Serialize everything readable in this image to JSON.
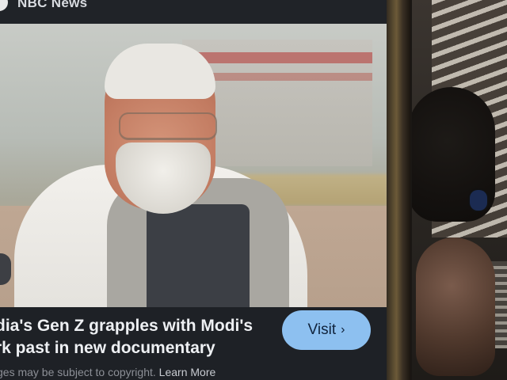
{
  "card": {
    "source": "NBC News",
    "headline_line1": "dia's Gen Z grapples with Modi's",
    "headline_line2": "rk past in new documentary",
    "visit_label": "Visit",
    "visit_chevron": "›",
    "copyright_text": "ges may be subject to copyright.",
    "learn_more": "Learn More"
  },
  "icons": [
    "chevron-right-icon",
    "source-logo-icon"
  ],
  "colors": {
    "visit_button": "#8dc0f0",
    "caption_bg": "#1e2126",
    "headline_text": "#eef0f3"
  }
}
